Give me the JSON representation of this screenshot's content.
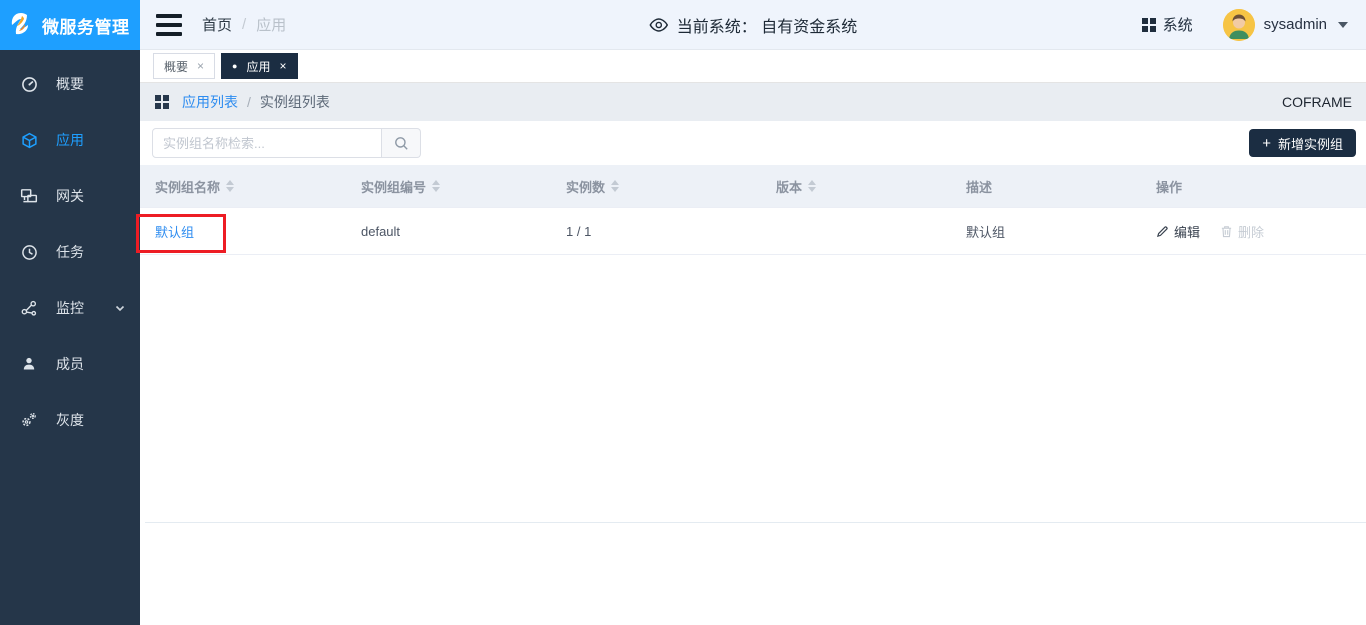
{
  "brand": {
    "title": "微服务管理"
  },
  "sidebar": {
    "items": [
      {
        "label": "概要"
      },
      {
        "label": "应用"
      },
      {
        "label": "网关"
      },
      {
        "label": "任务"
      },
      {
        "label": "监控"
      },
      {
        "label": "成员"
      },
      {
        "label": "灰度"
      }
    ]
  },
  "topbar": {
    "breadcrumb": {
      "home": "首页",
      "separator": "/",
      "current": "应用"
    },
    "current_system": "当前系统： 自有资金系统",
    "system_label": "系统",
    "username": "sysadmin"
  },
  "tabs": [
    {
      "label": "概要",
      "close": "×"
    },
    {
      "label": "应用",
      "close": "×",
      "dot": "●"
    }
  ],
  "pathbar": {
    "parent": "应用列表",
    "separator": "/",
    "current": "实例组列表",
    "right_label": "COFRAME"
  },
  "toolbar": {
    "search_placeholder": "实例组名称检索...",
    "add_plus": "+",
    "add_label": "新增实例组"
  },
  "table": {
    "columns": [
      {
        "label": "实例组名称",
        "sortable": true
      },
      {
        "label": "实例组编号",
        "sortable": true
      },
      {
        "label": "实例数",
        "sortable": true
      },
      {
        "label": "版本",
        "sortable": true
      },
      {
        "label": "描述",
        "sortable": false
      },
      {
        "label": "操作",
        "sortable": false
      }
    ],
    "rows": [
      {
        "name": "默认组",
        "code": "default",
        "instances": "1 / 1",
        "version": "",
        "description": "默认组"
      }
    ],
    "row_actions": {
      "edit": "编辑",
      "delete": "删除"
    }
  },
  "colors": {
    "accent_blue": "#1e9fff",
    "sidebar_bg": "#253649",
    "dark_navy": "#1b2d42",
    "link_blue": "#2d8cf0",
    "annotation_red": "#ed1c24"
  }
}
